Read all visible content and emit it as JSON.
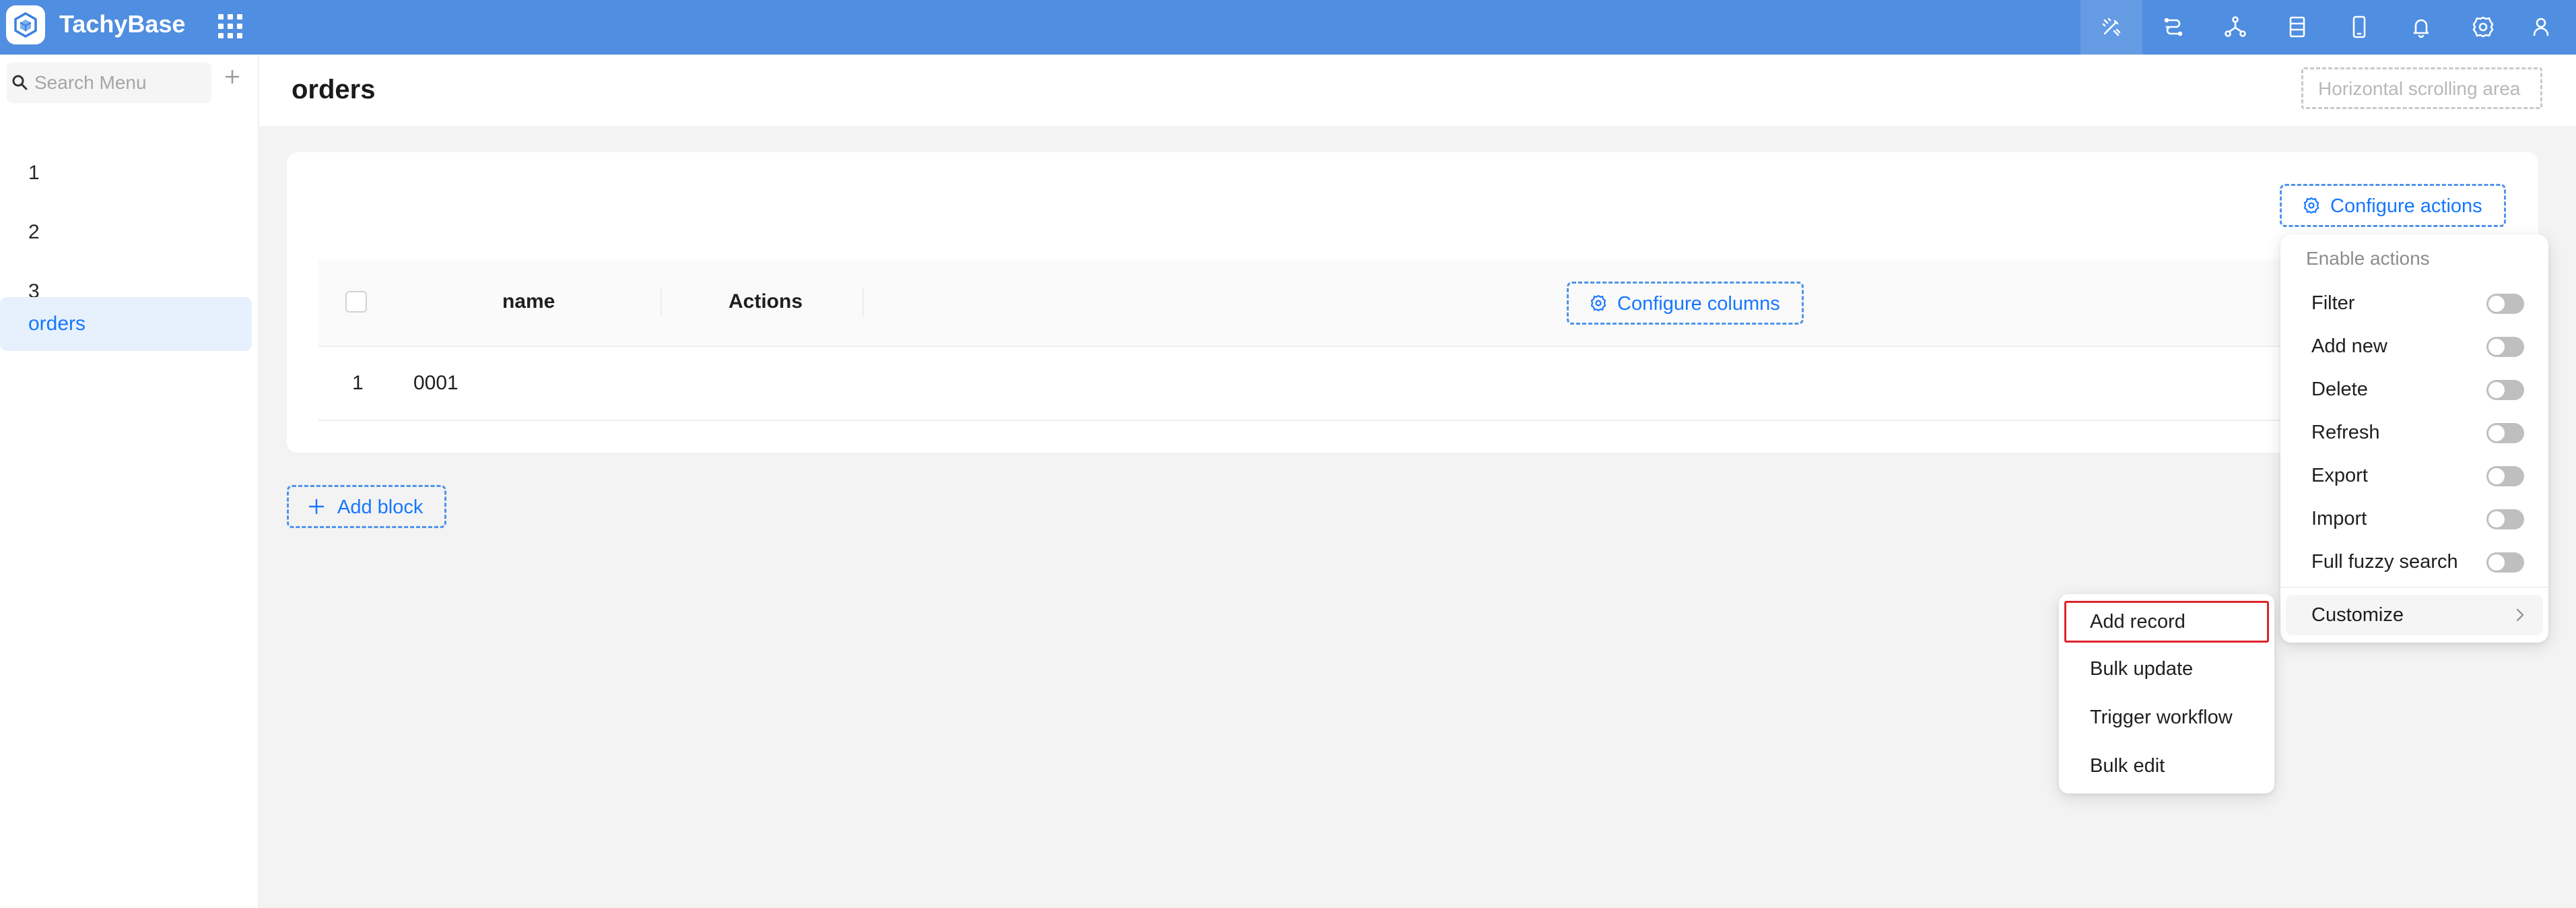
{
  "app": {
    "title": "TachyBase"
  },
  "colors": {
    "topbar": "#4f8ee0",
    "accent": "#1677ff",
    "highlight": "#e0242c"
  },
  "topbar": {
    "icons": [
      "ui-editor-icon",
      "plugin-icon",
      "workflow-icon",
      "data-source-icon",
      "mobile-icon",
      "bell-icon",
      "gear-icon",
      "user-icon"
    ]
  },
  "sidebar": {
    "search_placeholder": "Search Menu",
    "items": [
      {
        "label": "1"
      },
      {
        "label": "2"
      },
      {
        "label": "3"
      },
      {
        "label": "orders",
        "active": true
      }
    ]
  },
  "page": {
    "title": "orders",
    "horizontal_scroll_label": "Horizontal scrolling area"
  },
  "table": {
    "configure_actions_label": "Configure actions",
    "configure_columns_label": "Configure columns",
    "columns": [
      "name",
      "Actions"
    ],
    "rows": [
      {
        "index": "1",
        "name": "0001"
      }
    ]
  },
  "add_block_label": "Add block",
  "enable_actions_menu": {
    "title": "Enable actions",
    "items": [
      {
        "label": "Filter",
        "enabled": false
      },
      {
        "label": "Add new",
        "enabled": false
      },
      {
        "label": "Delete",
        "enabled": false
      },
      {
        "label": "Refresh",
        "enabled": false
      },
      {
        "label": "Export",
        "enabled": false
      },
      {
        "label": "Import",
        "enabled": false
      },
      {
        "label": "Full fuzzy search",
        "enabled": false
      }
    ],
    "customize_label": "Customize"
  },
  "customize_submenu": {
    "items": [
      {
        "label": "Add record",
        "highlighted": true
      },
      {
        "label": "Bulk update"
      },
      {
        "label": "Trigger workflow"
      },
      {
        "label": "Bulk edit"
      }
    ]
  }
}
